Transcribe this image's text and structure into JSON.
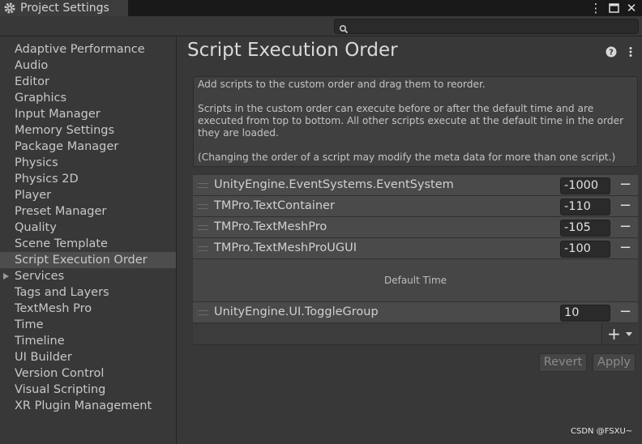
{
  "window": {
    "tab_title": "Project Settings",
    "controls": [
      "kebab-menu",
      "maximize",
      "close"
    ],
    "control_glyphs": {
      "menu": "⋮",
      "maximize": "▭",
      "close": "✕"
    }
  },
  "search": {
    "value": "",
    "placeholder": ""
  },
  "sidebar": {
    "items": [
      {
        "label": "Adaptive Performance"
      },
      {
        "label": "Audio"
      },
      {
        "label": "Editor"
      },
      {
        "label": "Graphics"
      },
      {
        "label": "Input Manager"
      },
      {
        "label": "Memory Settings"
      },
      {
        "label": "Package Manager"
      },
      {
        "label": "Physics"
      },
      {
        "label": "Physics 2D"
      },
      {
        "label": "Player"
      },
      {
        "label": "Preset Manager"
      },
      {
        "label": "Quality"
      },
      {
        "label": "Scene Template"
      },
      {
        "label": "Script Execution Order",
        "selected": true
      },
      {
        "label": "Services",
        "expandable": true
      },
      {
        "label": "Tags and Layers"
      },
      {
        "label": "TextMesh Pro"
      },
      {
        "label": "Time"
      },
      {
        "label": "Timeline"
      },
      {
        "label": "UI Builder"
      },
      {
        "label": "Version Control"
      },
      {
        "label": "Visual Scripting"
      },
      {
        "label": "XR Plugin Management"
      }
    ]
  },
  "main": {
    "title": "Script Execution Order",
    "help": {
      "line1": "Add scripts to the custom order and drag them to reorder.",
      "line2": "Scripts in the custom order can execute before or after the default time and are executed from top to bottom. All other scripts execute at the default time in the order they are loaded.",
      "line3": "(Changing the order of a script may modify the meta data for more than one script.)"
    },
    "before_default": [
      {
        "name": "UnityEngine.EventSystems.EventSystem",
        "order": "-1000"
      },
      {
        "name": "TMPro.TextContainer",
        "order": "-110"
      },
      {
        "name": "TMPro.TextMeshPro",
        "order": "-105"
      },
      {
        "name": "TMPro.TextMeshProUGUI",
        "order": "-100"
      }
    ],
    "default_time_label": "Default Time",
    "after_default": [
      {
        "name": "UnityEngine.UI.ToggleGroup",
        "order": "10"
      }
    ],
    "remove_glyph": "−",
    "add_glyph": "+",
    "revert_label": "Revert",
    "apply_label": "Apply"
  },
  "watermark": "CSDN @FSXU~",
  "colors": {
    "background": "#383838",
    "titlebar": "#191919",
    "row": "#4a4a4a",
    "selected": "#4d4d4d",
    "field": "#2a2a2a"
  }
}
